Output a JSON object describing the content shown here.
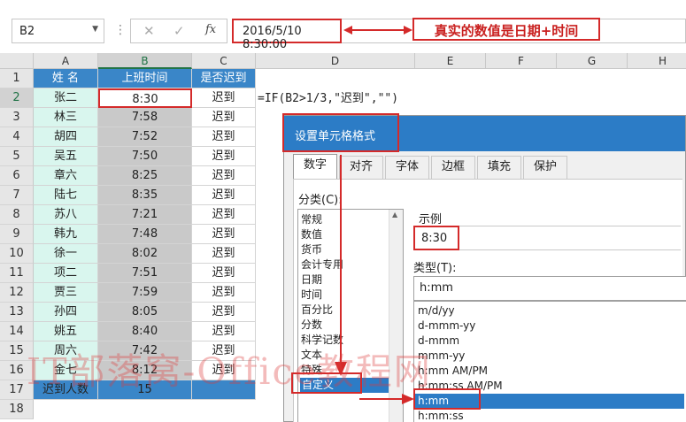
{
  "formula_bar": {
    "name_box": "B2",
    "cancel_icon": "✕",
    "enter_icon": "✓",
    "fx_label": "fx",
    "value": "2016/5/10  8:30:00"
  },
  "annotation": {
    "note": "真实的数值是日期+时间"
  },
  "sheet": {
    "columns": [
      "A",
      "B",
      "C",
      "D",
      "E",
      "F",
      "G",
      "H"
    ],
    "header": {
      "name": "姓 名",
      "time": "上班时间",
      "late": "是否迟到"
    },
    "rows": [
      {
        "num": "2",
        "name": "张二",
        "time": "8:30",
        "late": "迟到"
      },
      {
        "num": "3",
        "name": "林三",
        "time": "7:58",
        "late": "迟到"
      },
      {
        "num": "4",
        "name": "胡四",
        "time": "7:52",
        "late": "迟到"
      },
      {
        "num": "5",
        "name": "吴五",
        "time": "7:50",
        "late": "迟到"
      },
      {
        "num": "6",
        "name": "章六",
        "time": "8:25",
        "late": "迟到"
      },
      {
        "num": "7",
        "name": "陆七",
        "time": "8:35",
        "late": "迟到"
      },
      {
        "num": "8",
        "name": "苏八",
        "time": "7:21",
        "late": "迟到"
      },
      {
        "num": "9",
        "name": "韩九",
        "time": "7:48",
        "late": "迟到"
      },
      {
        "num": "10",
        "name": "徐一",
        "time": "8:02",
        "late": "迟到"
      },
      {
        "num": "11",
        "name": "项二",
        "time": "7:51",
        "late": "迟到"
      },
      {
        "num": "12",
        "name": "贾三",
        "time": "7:59",
        "late": "迟到"
      },
      {
        "num": "13",
        "name": "孙四",
        "time": "8:05",
        "late": "迟到"
      },
      {
        "num": "14",
        "name": "姚五",
        "time": "8:40",
        "late": "迟到"
      },
      {
        "num": "15",
        "name": "周六",
        "time": "7:42",
        "late": "迟到"
      },
      {
        "num": "16",
        "name": "金七",
        "time": "8:12",
        "late": "迟到"
      }
    ],
    "total": {
      "num": "17",
      "label": "迟到人数",
      "value": "15"
    },
    "header_row_num": "1",
    "last_row_num": "18",
    "formula_text": "=IF(B2>1/3,\"迟到\",\"\")"
  },
  "dialog": {
    "title": "设置单元格格式",
    "tabs": [
      "数字",
      "对齐",
      "字体",
      "边框",
      "填充",
      "保护"
    ],
    "category_label": "分类(C):",
    "categories": [
      "常规",
      "数值",
      "货币",
      "会计专用",
      "日期",
      "时间",
      "百分比",
      "分数",
      "科学记数",
      "文本",
      "特殊",
      "自定义"
    ],
    "selected_category": "自定义",
    "sample_label": "示例",
    "sample_value": "8:30",
    "type_label": "类型(T):",
    "type_value": "h:mm",
    "type_list": [
      "m/d/yy",
      "d-mmm-yy",
      "d-mmm",
      "mmm-yy",
      "h:mm AM/PM",
      "h:mm:ss AM/PM",
      "h:mm",
      "h:mm:ss"
    ],
    "selected_type": "h:mm"
  },
  "watermark": "IT部落窝-Office教程网",
  "colors": {
    "header_blue": "#3a86c8",
    "accent_red": "#d42a2a",
    "name_col": "#d9f6ee",
    "time_col": "#c9c9c9",
    "dialog_title": "#2c7cc6"
  }
}
